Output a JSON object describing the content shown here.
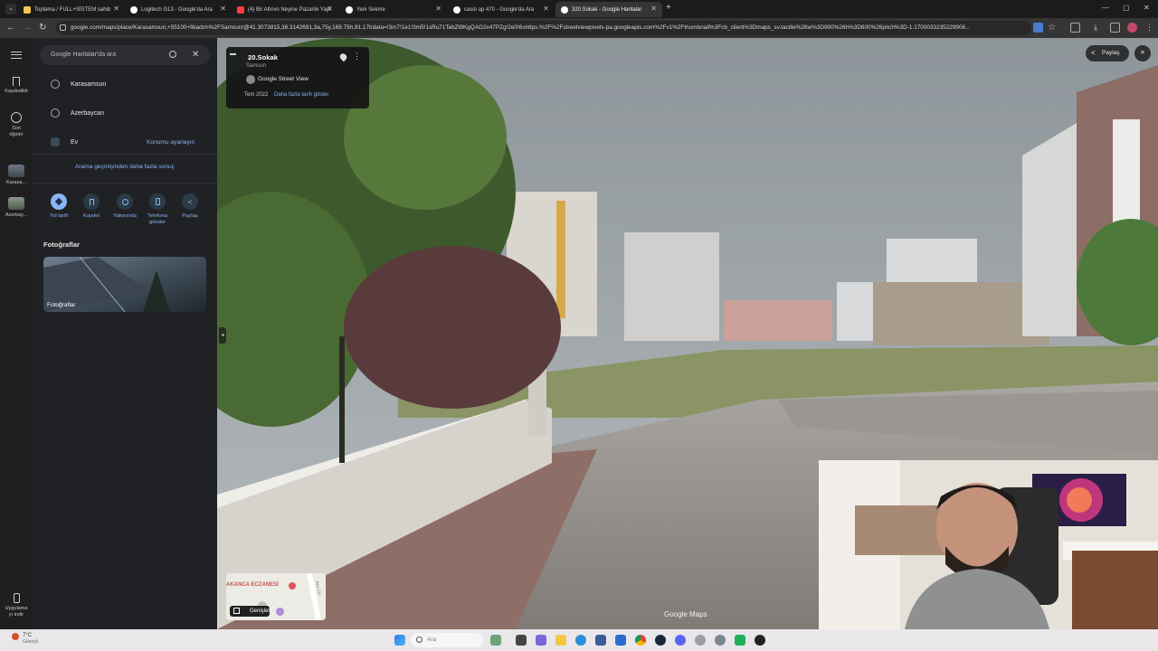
{
  "browser": {
    "tabs": [
      {
        "label": "Toplama / FULL+SİSTEM sahib",
        "favicon_color": "#f2c94c"
      },
      {
        "label": "Logitech G13 - Google'da Ara",
        "favicon_color": "#ffffff"
      },
      {
        "label": "(4) Bir Altının Neyine Pazarlık Yapı",
        "favicon_color": "#ff3b3b"
      },
      {
        "label": "Yeni Sekme",
        "favicon_color": "#ffffff"
      },
      {
        "label": "casio ap 470 - Google'da Ara",
        "favicon_color": "#ffffff"
      },
      {
        "label": "320.Sokak - Google Haritalar",
        "favicon_color": "#ffffff"
      }
    ],
    "new_tab_label": "+",
    "url": "google.com/maps/place/Karasamsun,+55100+İlkadım%2FSamsun/@41.3073815,36.3142691,3a,75y,169.75h,91.17t/data=!3m7!1e1!3m5!1sRu71TebZt9KgQAG2x47PZg!2e0!6shttps:%2F%2Fstreetviewpixels-pa.googleapis.com%2Fv1%2Fthumbnail%3Fcb_client%3Dmaps_sv.tactile%26w%3D900%26h%3D600%26pitch%3D-1.1700033235229906..."
  },
  "rail": {
    "menu_icon": "hamburger-icon",
    "items": [
      {
        "label": "Kaydedildi",
        "icon": "bookmark-icon"
      },
      {
        "label": "Son öğeler",
        "icon": "history-icon"
      },
      {
        "label": "Karasa...",
        "icon": "place-thumb"
      },
      {
        "label": "Azerbay...",
        "icon": "place-thumb"
      }
    ],
    "bottom_label": "Uygulama yı indir"
  },
  "panel": {
    "search_placeholder": "Google Haritalar'da ara",
    "history": [
      {
        "label": "Karasamsun",
        "icon": "clock-icon"
      },
      {
        "label": "Azerbaycan",
        "icon": "clock-icon"
      },
      {
        "label": "Ev",
        "icon": "home-icon",
        "action": "Konumu ayarlayın"
      }
    ],
    "more_results": "Arama geçmişinden daha fazla sonuç",
    "actions": [
      {
        "label": "Yol tarifi",
        "icon": "directions-icon"
      },
      {
        "label": "Kaydet",
        "icon": "bookmark-icon"
      },
      {
        "label": "Yakınında",
        "icon": "nearby-icon"
      },
      {
        "label": "Telefona gönder",
        "icon": "phone-icon"
      },
      {
        "label": "Paylaş",
        "icon": "share-icon"
      }
    ],
    "photos_title": "Fotoğraflar",
    "photo_label": "Fotoğraflar"
  },
  "streetview": {
    "place_title": "20.Sokak",
    "place_subtitle": "Samsun",
    "provider": "Google Street View",
    "date": "Tem 2022",
    "more_dates": "Daha fazla tarih göster",
    "share_label": "Paylaş",
    "watermark": "Google Maps",
    "minimap_label": "AKANCA ECZANESİ",
    "minimap_street": "Ata Cd.",
    "expand_label": "Genişlet"
  },
  "taskbar": {
    "weather": "7°C",
    "weather_sub": "Güneşli",
    "search": "Ara"
  },
  "colors": {
    "accent": "#8ab4f8",
    "panel_bg": "#202124",
    "rail_bg": "#1f1f1f"
  }
}
